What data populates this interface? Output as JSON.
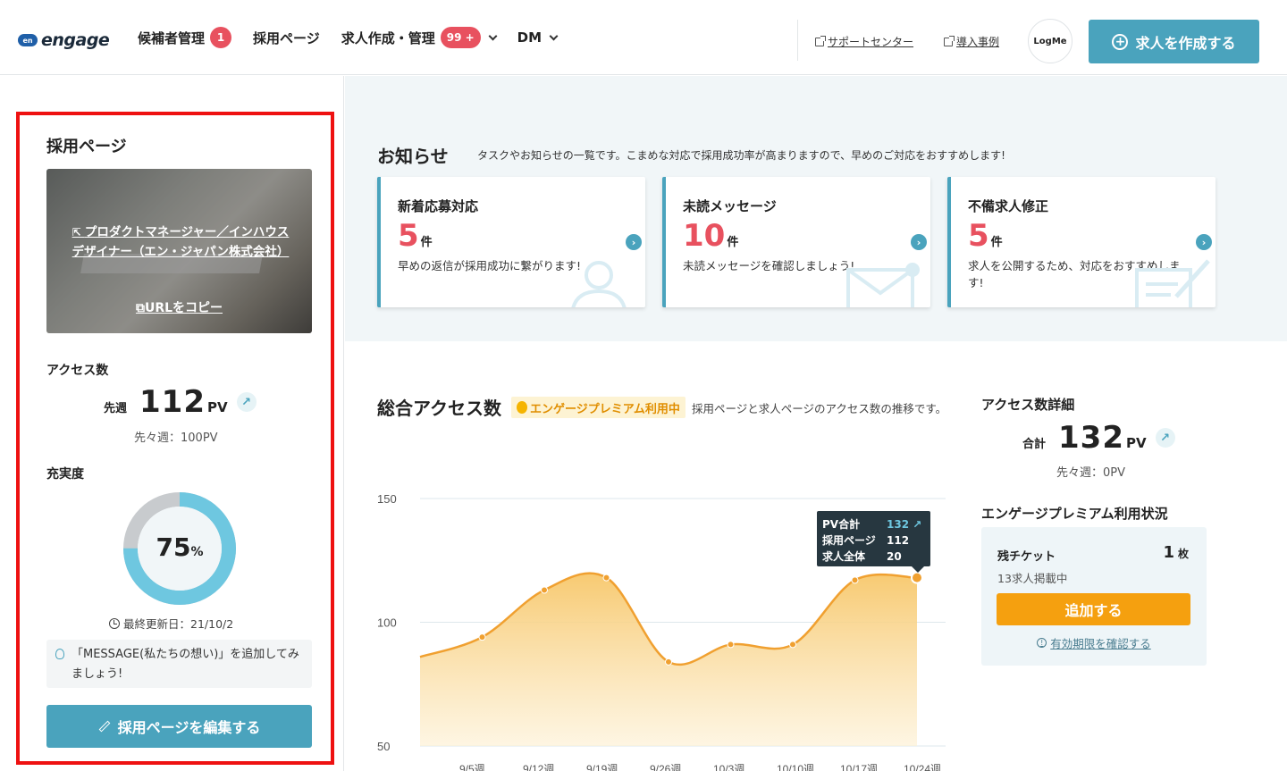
{
  "header": {
    "logo_mark": "en",
    "logo_text": "engage",
    "nav": [
      {
        "label": "候補者管理",
        "badge": "1"
      },
      {
        "label": "採用ページ"
      },
      {
        "label": "求人作成・管理",
        "badge": "99 +",
        "dropdown": true
      },
      {
        "label": "DM",
        "dropdown": true
      }
    ],
    "support_link": "サポートセンター",
    "cases_link": "導入事例",
    "logme": "LogMe",
    "create_button": "求人を作成する"
  },
  "recruit_page": {
    "title": "採用ページ",
    "page_link": "プロダクトマネージャー／インハウスデザイナー（エン・ジャパン株式会社）",
    "copy_url": "URLをコピー",
    "access_label": "アクセス数",
    "last_week_label": "先週",
    "pv_value": "112",
    "pv_unit": "PV",
    "prev_week": "先々週：100PV",
    "fulfillment_label": "充実度",
    "fulfillment_value": "75",
    "fulfillment_unit": "%",
    "fulfillment_fraction": 0.75,
    "last_updated": "最終更新日：21/10/2",
    "tip": "「MESSAGE(私たちの想い)」を追加してみましょう!",
    "edit_button": "採用ページを編集する"
  },
  "notices": {
    "title": "お知らせ",
    "subtitle": "タスクやお知らせの一覧です。こまめな対応で採用成功率が高まりますので、早めのご対応をおすすめします!",
    "cards": [
      {
        "title": "新着応募対応",
        "count": "5",
        "unit": "件",
        "desc": "早めの返信が採用成功に繋がります!"
      },
      {
        "title": "未読メッセージ",
        "count": "10",
        "unit": "件",
        "desc": "未読メッセージを確認しましょう!"
      },
      {
        "title": "不備求人修正",
        "count": "5",
        "unit": "件",
        "desc": "求人を公開するため、対応をおすすめします!"
      }
    ]
  },
  "access": {
    "title": "総合アクセス数",
    "premium_tag": "エンゲージプレミアム利用中",
    "subtitle": "採用ページと求人ページのアクセス数の推移です。",
    "tooltip": {
      "rows": [
        {
          "label": "PV合計",
          "value": "132 ↗"
        },
        {
          "label": "採用ページ",
          "value": "112"
        },
        {
          "label": "求人全体",
          "value": "20"
        }
      ]
    }
  },
  "chart_data": {
    "type": "area",
    "y_ticks": [
      150,
      100,
      50
    ],
    "ylim": [
      50,
      150
    ],
    "x": [
      "9/5週",
      "9/12週",
      "9/19週",
      "9/26週",
      "10/3週",
      "10/10週",
      "10/17週",
      "10/24週"
    ],
    "values": [
      86,
      94,
      113,
      118,
      84,
      91,
      91,
      117,
      118
    ],
    "accent": "#f0a030",
    "fill": "#fbd98a"
  },
  "access_detail": {
    "title": "アクセス数詳細",
    "total_label": "合計",
    "total_value": "132",
    "unit": "PV",
    "prev": "先々週：0PV"
  },
  "premium": {
    "title": "エンゲージプレミアム利用状況",
    "ticket_label": "残チケット",
    "ticket_value": "1",
    "ticket_unit": "枚",
    "ticket_sub": "13求人掲載中",
    "add_button": "追加する",
    "expiry_link": "有効期限を確認する"
  }
}
